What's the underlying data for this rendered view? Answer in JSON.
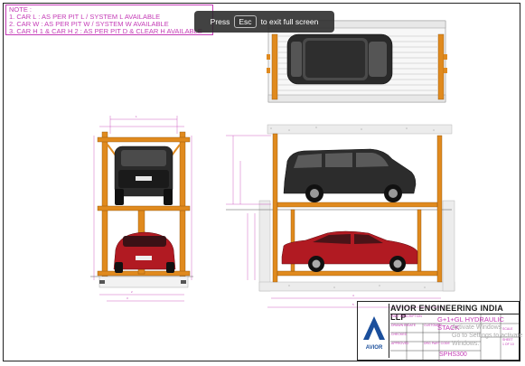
{
  "note": {
    "heading": "NOTE :",
    "lines": [
      "1. CAR L : AS PER PIT L / SYSTEM L AVAILABLE",
      "2. CAR W : AS PER PIT W / SYSTEM W AVAILABLE",
      "3. CAR H 1 & CAR H 2 : AS PER PIT D & CLEAR H AVAILABLE"
    ]
  },
  "toast": {
    "press": "Press",
    "key": "Esc",
    "action": "to exit full screen"
  },
  "title_block": {
    "company": "AVIOR ENGINEERING INDIA LLP",
    "title": "G+1+GL HYDRAULIC STACK",
    "drawing_no": "SPHS300",
    "part_description_label": "PART DESCRIPTION",
    "drawn_by_label": "DRAWN BY",
    "checked_label": "CHECKED",
    "approved_label": "APPROVED",
    "date_label": "DATE",
    "customer_label": "CUSTOMER",
    "dwg_part_label": "DRG PART CODE",
    "scale_label": "SCALE",
    "sheet_label": "SHEET",
    "sheet_value": "1 OF 10"
  },
  "watermark": {
    "line1": "Activate Windows",
    "line2": "Go to Settings to activate Windows."
  },
  "colors": {
    "accent": "#c43bb6",
    "frame_orange": "#e08a1e",
    "car_dark": "#222222",
    "car_red": "#b11a22",
    "ground": "#9a9a9a"
  }
}
